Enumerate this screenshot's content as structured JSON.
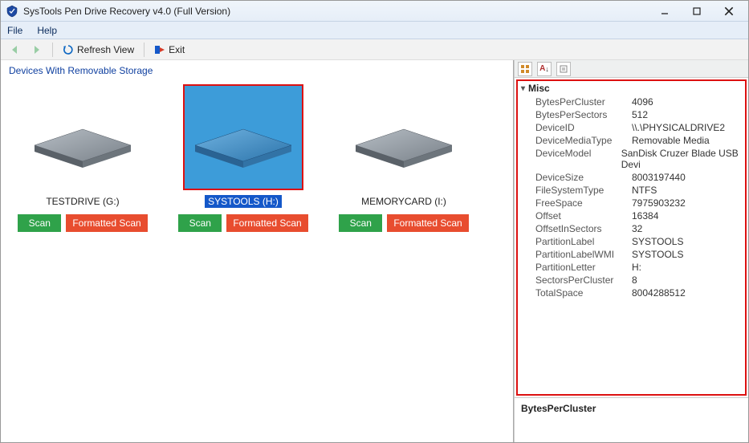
{
  "window": {
    "title": "SysTools Pen Drive Recovery v4.0 (Full Version)"
  },
  "menu": {
    "file": "File",
    "help": "Help"
  },
  "toolbar": {
    "refresh": "Refresh View",
    "exit": "Exit"
  },
  "left": {
    "header": "Devices With Removable Storage",
    "scan_label": "Scan",
    "formatted_label": "Formatted Scan"
  },
  "drives": [
    {
      "label": "TESTDRIVE (G:)",
      "selected": false
    },
    {
      "label": "SYSTOOLS (H:)",
      "selected": true
    },
    {
      "label": "MEMORYCARD (I:)",
      "selected": false
    }
  ],
  "properties": {
    "category": "Misc",
    "rows": [
      {
        "k": "BytesPerCluster",
        "v": "4096"
      },
      {
        "k": "BytesPerSectors",
        "v": "512"
      },
      {
        "k": "DeviceID",
        "v": "\\\\.\\PHYSICALDRIVE2"
      },
      {
        "k": "DeviceMediaType",
        "v": "Removable Media"
      },
      {
        "k": "DeviceModel",
        "v": "SanDisk Cruzer Blade USB Devi"
      },
      {
        "k": "DeviceSize",
        "v": "8003197440"
      },
      {
        "k": "FileSystemType",
        "v": "NTFS"
      },
      {
        "k": "FreeSpace",
        "v": "7975903232"
      },
      {
        "k": "Offset",
        "v": "16384"
      },
      {
        "k": "OffsetInSectors",
        "v": "32"
      },
      {
        "k": "PartitionLabel",
        "v": "SYSTOOLS"
      },
      {
        "k": "PartitionLabelWMI",
        "v": "SYSTOOLS"
      },
      {
        "k": "PartitionLetter",
        "v": "H:"
      },
      {
        "k": "SectorsPerCluster",
        "v": "8"
      },
      {
        "k": "TotalSpace",
        "v": "8004288512"
      }
    ],
    "footer_key": "BytesPerCluster"
  }
}
